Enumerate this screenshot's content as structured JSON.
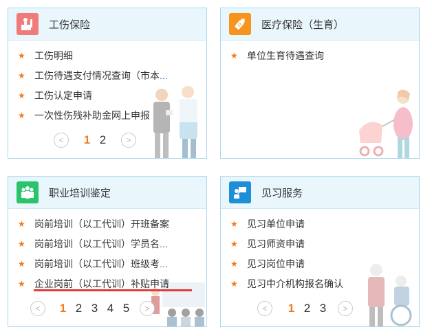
{
  "cards": [
    {
      "title": "工伤保险",
      "icon": "injured-worker-icon",
      "icon_color": "#f07b7b",
      "items": [
        {
          "text": "工伤明细",
          "more": ""
        },
        {
          "text": "工伤待遇支付情况查询（市本",
          "more": "..."
        },
        {
          "text": "工伤认定申请",
          "more": ""
        },
        {
          "text": "一次性伤残补助金网上申报",
          "more": ""
        }
      ],
      "pager": {
        "prev": "<",
        "next": ">",
        "pages": [
          "1",
          "2"
        ],
        "active": "1"
      }
    },
    {
      "title": "医疗保险（生育）",
      "icon": "baby-bottle-icon",
      "icon_color": "#f7941d",
      "items": [
        {
          "text": "单位生育待遇查询",
          "more": ""
        }
      ]
    },
    {
      "title": "职业培训鉴定",
      "icon": "group-training-icon",
      "icon_color": "#2bc36b",
      "items": [
        {
          "text": "岗前培训（以工代训）开班备案",
          "more": ""
        },
        {
          "text": "岗前培训（以工代训）学员名",
          "more": "..."
        },
        {
          "text": "岗前培训（以工代训）班级考",
          "more": "..."
        },
        {
          "text": "企业岗前（以工代训）补贴申请",
          "more": ""
        }
      ],
      "pager": {
        "prev": "<",
        "next": ">",
        "pages": [
          "1",
          "2",
          "3",
          "4",
          "5"
        ],
        "active": "1"
      }
    },
    {
      "title": "见习服务",
      "icon": "intern-presentation-icon",
      "icon_color": "#1d8fd8",
      "items": [
        {
          "text": "见习单位申请",
          "more": ""
        },
        {
          "text": "见习师资申请",
          "more": ""
        },
        {
          "text": "见习岗位申请",
          "more": ""
        },
        {
          "text": "见习中介机构报名确认",
          "more": ""
        }
      ],
      "pager": {
        "prev": "<",
        "next": ">",
        "pages": [
          "1",
          "2",
          "3"
        ],
        "active": "1"
      }
    }
  ],
  "star_glyph": "★",
  "accent_color": "#f07a1c",
  "highlight_color": "#e03a3a"
}
